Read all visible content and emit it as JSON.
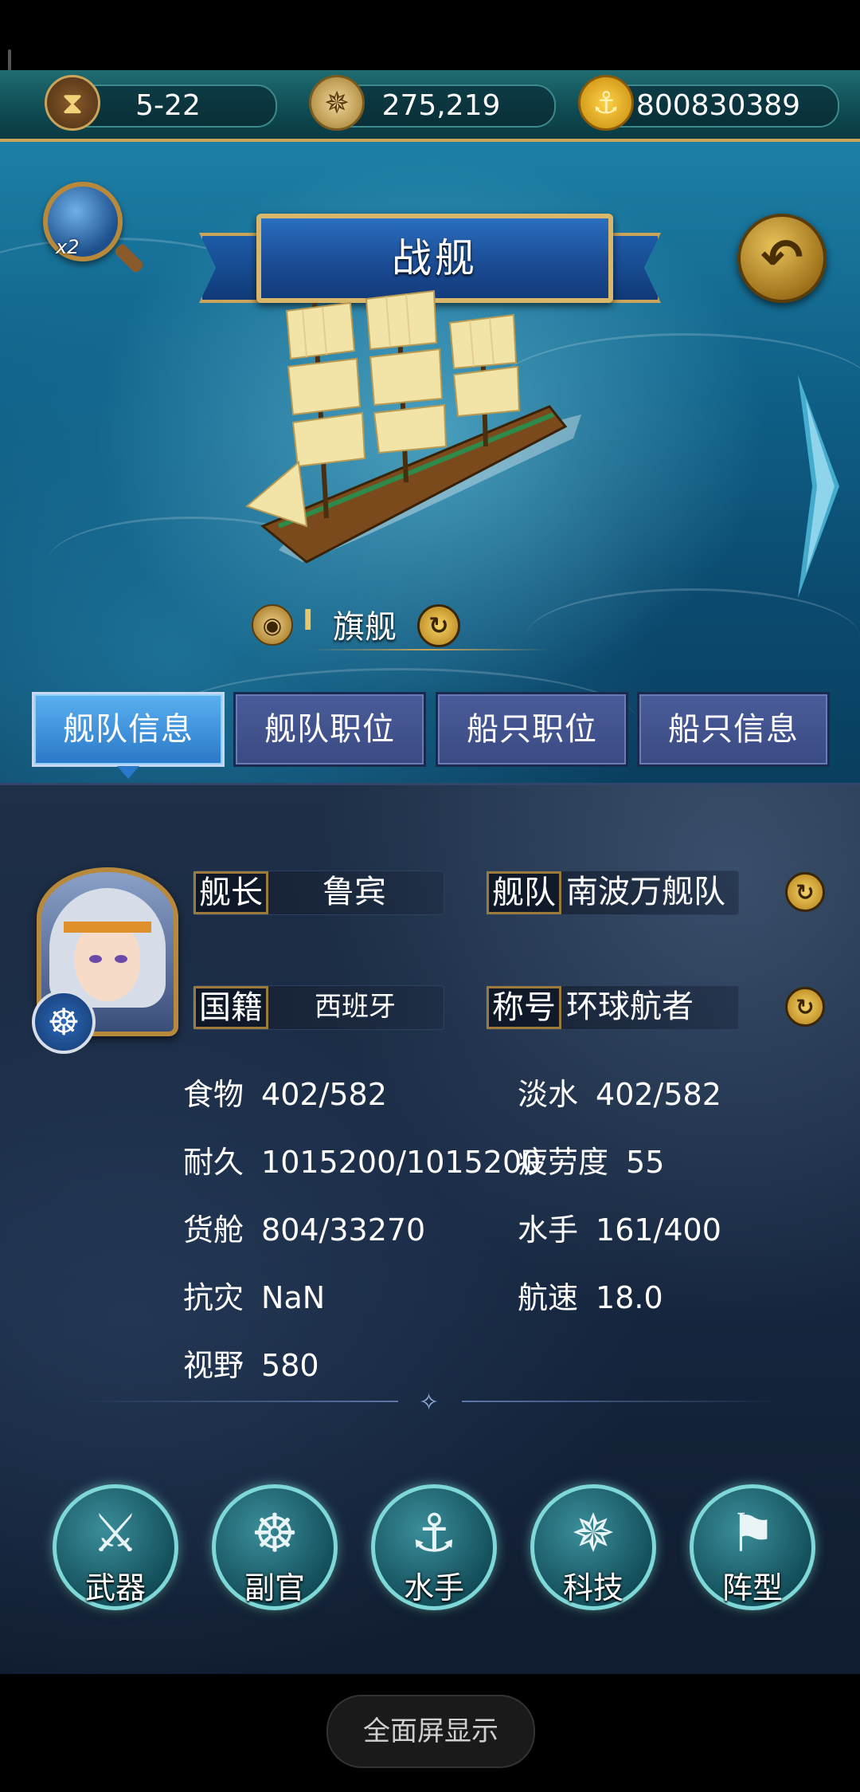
{
  "resources": {
    "time": "5-22",
    "compass_value": "275,219",
    "gold": "800830389",
    "icons": [
      "hourglass-icon",
      "compass-icon",
      "coin-icon"
    ]
  },
  "scene": {
    "zoom_badge": "x2",
    "title": "战舰",
    "flagship_rank": "I",
    "flagship_label": "旗舰"
  },
  "tabs": [
    {
      "label": "舰队信息",
      "active": true
    },
    {
      "label": "舰队职位",
      "active": false
    },
    {
      "label": "船只职位",
      "active": false
    },
    {
      "label": "船只信息",
      "active": false
    }
  ],
  "captain": {
    "captain_label": "舰长",
    "captain_value": "鲁宾",
    "fleet_label": "舰队",
    "fleet_value": "南波万舰队",
    "nation_label": "国籍",
    "nation_value": "西班牙",
    "title_label": "称号",
    "title_value": "环球航者"
  },
  "stats": {
    "food": {
      "label": "食物",
      "value": "402/582"
    },
    "water": {
      "label": "淡水",
      "value": "402/582"
    },
    "durability": {
      "label": "耐久",
      "value": "1015200/1015200"
    },
    "fatigue": {
      "label": "疲劳度",
      "value": "55"
    },
    "cargo": {
      "label": "货舱",
      "value": "804/33270"
    },
    "sailors": {
      "label": "水手",
      "value": "161/400"
    },
    "disaster_resist": {
      "label": "抗灾",
      "value": "NaN"
    },
    "speed": {
      "label": "航速",
      "value": "18.0"
    },
    "vision": {
      "label": "视野",
      "value": "580"
    }
  },
  "actions": [
    {
      "label": "武器",
      "icon": "sword-icon"
    },
    {
      "label": "副官",
      "icon": "helm-icon"
    },
    {
      "label": "水手",
      "icon": "hook-icon"
    },
    {
      "label": "科技",
      "icon": "compass-icon"
    },
    {
      "label": "阵型",
      "icon": "flag-icon"
    }
  ],
  "bottom": {
    "fullscreen_label": "全面屏显示"
  },
  "colors": {
    "accent_gold": "#c9a45a",
    "tab_active": "#2a78c8",
    "tab_inactive": "#3a4a82",
    "action_glow": "#7fd8d8"
  }
}
